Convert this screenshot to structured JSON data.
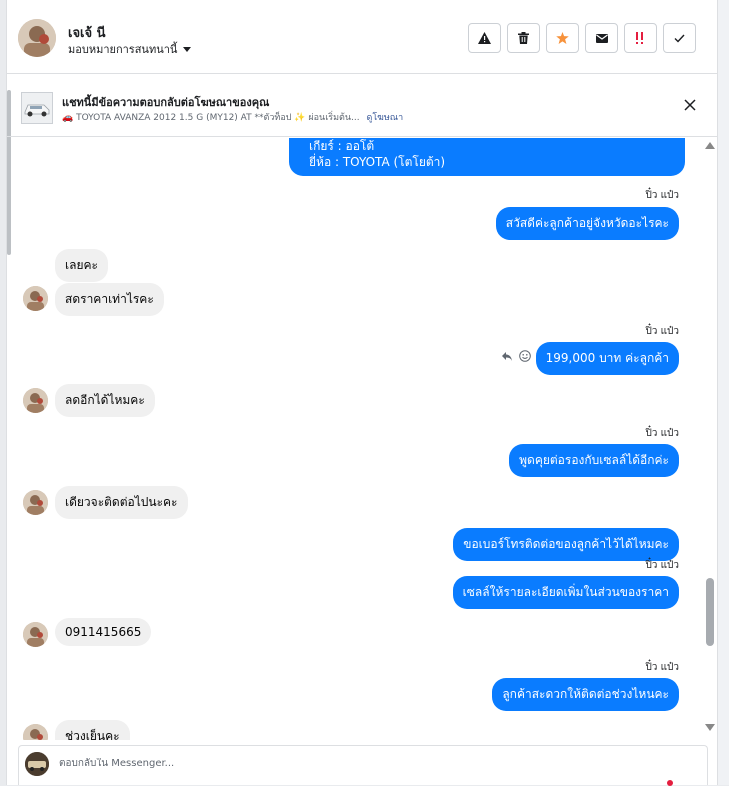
{
  "header": {
    "name": "เจเจ้ นี",
    "assign_label": "มอบหมายการสนทนานี้",
    "actions": [
      {
        "icon": "warning-icon"
      },
      {
        "icon": "trash-icon"
      },
      {
        "icon": "star-icon",
        "color": "#f7923b"
      },
      {
        "icon": "envelope-icon"
      },
      {
        "icon": "important-icon",
        "color": "#e41e3f"
      },
      {
        "icon": "check-icon"
      }
    ]
  },
  "ad": {
    "title": "แชทนี้มีข้อความตอบกลับต่อโฆษณาของคุณ",
    "subtitle": "🚗 TOYOTA AVANZA 2012 1.5 G (MY12) AT **ตัวท็อป ✨ ผ่อนเริ่มต้น...",
    "link": "ดูโฆษณา"
  },
  "chat": {
    "top_bubble_lines": [
      "เกียร์ : ออโต้",
      "ยี่ห้อ : TOYOTA (โตโยต้า)"
    ],
    "messages": [
      {
        "dir": "out",
        "sender": "ปิ๋ว แป๋ว",
        "text": "สวัสดีค่ะลูกค้าอยู่จังหวัดอะไรคะ"
      },
      {
        "dir": "in",
        "text": "เลยคะ"
      },
      {
        "dir": "in",
        "text": "สดราคาเท่าไรคะ"
      },
      {
        "dir": "out",
        "sender": "ปิ๋ว แป๋ว",
        "text": "199,000 บาท ค่ะลูกค้า"
      },
      {
        "dir": "in",
        "text": "ลดอีกได้ไหมคะ"
      },
      {
        "dir": "out",
        "sender": "ปิ๋ว แป๋ว",
        "text": "พูดคุยต่อรองกับเซลล์ได้อีกค่ะ"
      },
      {
        "dir": "in",
        "text": "เดียวจะติดต่อไปนะคะ"
      },
      {
        "dir": "out",
        "text": "ขอเบอร์โทรติดต่อของลูกค้าไว้ได้ไหมคะ"
      },
      {
        "dir": "out",
        "sender": "ปิ๋ว แป๋ว",
        "text": "เซลล์ให้รายละเอียดเพิ่มในส่วนของราคา"
      },
      {
        "dir": "in",
        "text": "0911415665"
      },
      {
        "dir": "out",
        "sender": "ปิ๋ว แป๋ว",
        "text": "ลูกค้าสะดวกให้ติดต่อช่วงไหนคะ"
      },
      {
        "dir": "in",
        "text": "ช่วงเย็นคะ"
      }
    ]
  },
  "composer": {
    "placeholder": "ตอบกลับใน Messenger..."
  },
  "colors": {
    "outgoing_bubble": "#0a7cff",
    "incoming_bubble": "#f0f0f0"
  }
}
